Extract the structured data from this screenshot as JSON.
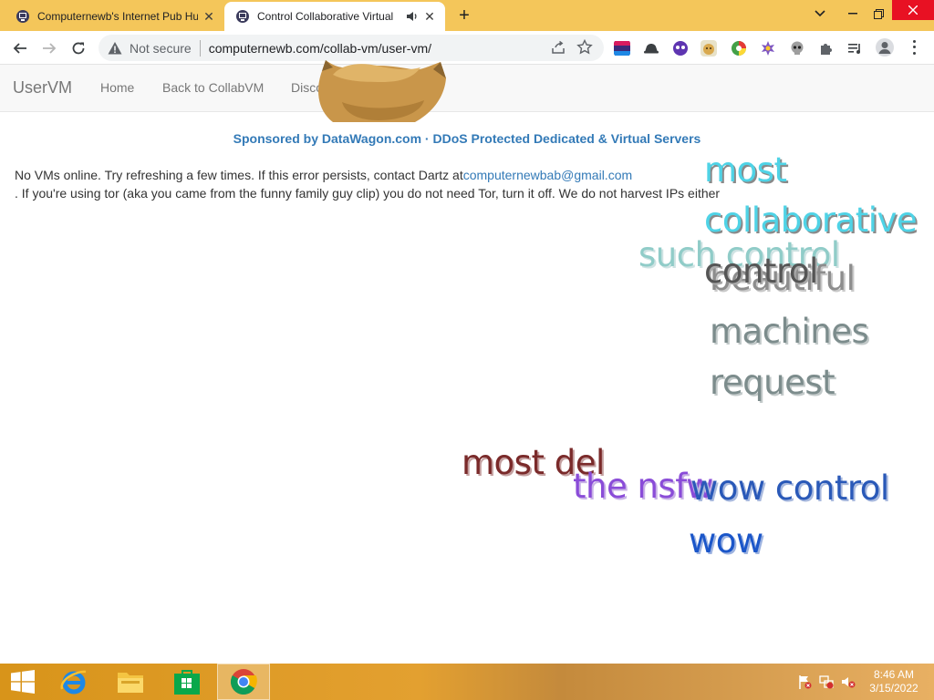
{
  "browser": {
    "tabs": [
      {
        "title": "Computernewb's Internet Pub Hu"
      },
      {
        "title": "Control Collaborative Virtual"
      }
    ],
    "omnibox": {
      "security_label": "Not secure",
      "url": "computernewb.com/collab-vm/user-vm/"
    }
  },
  "navbar": {
    "brand": "UserVM",
    "links": [
      {
        "label": "Home"
      },
      {
        "label": "Back to CollabVM"
      },
      {
        "label": "Disco"
      }
    ]
  },
  "content": {
    "sponsor": "Sponsored by DataWagon.com · DDoS Protected Dedicated & Virtual Servers",
    "message_line1": "No VMs online. Try refreshing a few times. If this error persists, contact Dartz at",
    "email": "computernewbab@gmail.com",
    "message_line2": ". If you're using tor (aka you came from the funny family guy clip) you do not need Tor, turn it off. We do not harvest IPs either"
  },
  "doge_words": {
    "most": "most",
    "collaborative": "collaborative",
    "such_control": "such control",
    "beautiful": "beautiful",
    "control": "control",
    "machines": "machines",
    "request": "request",
    "most_del": "most del",
    "the_nsfw": "the nsfw",
    "wow_control": "wow control",
    "wow": "wow"
  },
  "taskbar": {
    "time": "8:46 AM",
    "date": "3/15/2022"
  },
  "colors": {
    "tabstrip": "#f4c65a",
    "link": "#337ab7",
    "close_button": "#e81123"
  }
}
